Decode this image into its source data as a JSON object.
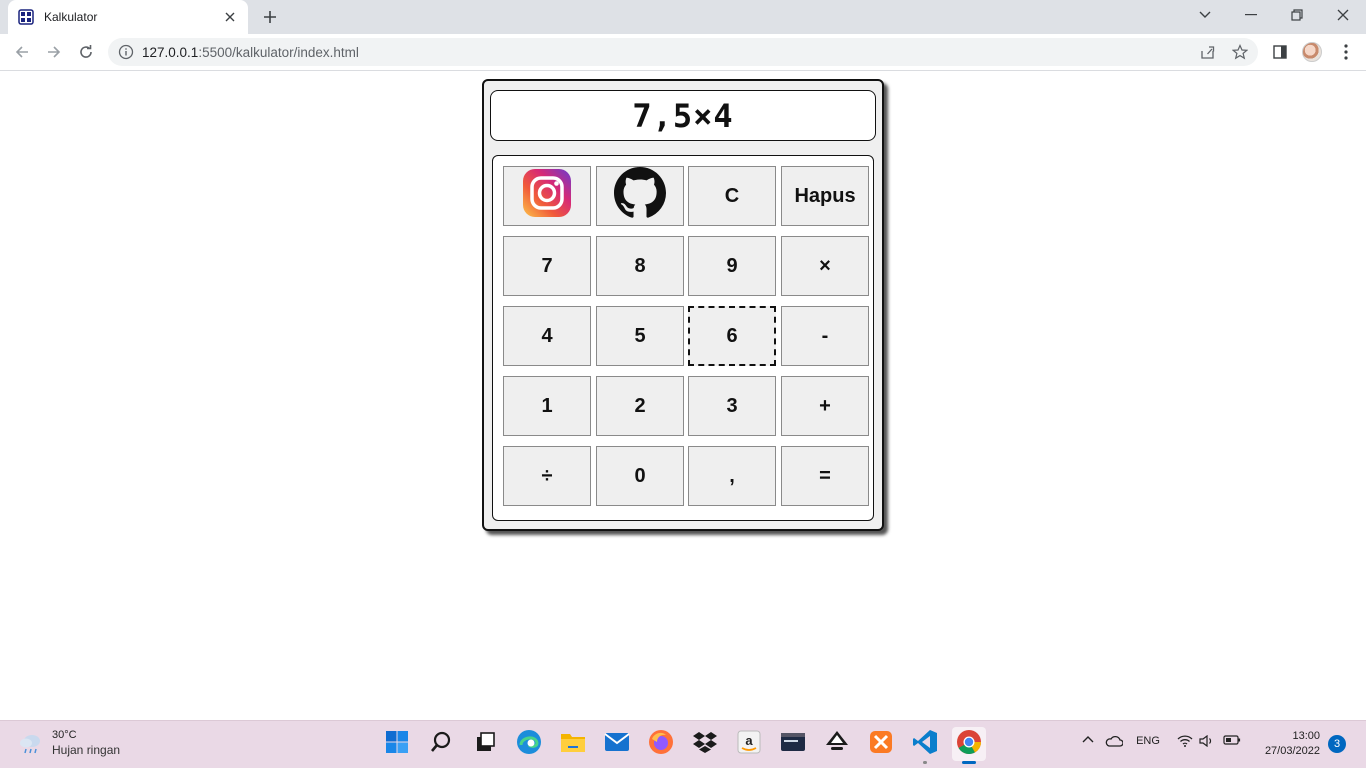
{
  "browser": {
    "tab_title": "Kalkulator",
    "url_host": "127.0.0.1",
    "url_rest": ":5500/kalkulator/index.html"
  },
  "calculator": {
    "display": "7,5×4",
    "keys": {
      "instagram": "",
      "github": "",
      "clear": "C",
      "delete": "Hapus",
      "k7": "7",
      "k8": "8",
      "k9": "9",
      "multiply": "×",
      "k4": "4",
      "k5": "5",
      "k6": "6",
      "minus": "-",
      "k1": "1",
      "k2": "2",
      "k3": "3",
      "plus": "+",
      "divide": "÷",
      "k0": "0",
      "comma": ",",
      "equals": "="
    }
  },
  "taskbar": {
    "weather_temp": "30°C",
    "weather_desc": "Hujan ringan",
    "language": "ENG",
    "time": "13:00",
    "date": "27/03/2022",
    "notifications": "3"
  },
  "colors": {
    "accent": "#0067c0",
    "taskbar_bg": "#ead9e6"
  }
}
